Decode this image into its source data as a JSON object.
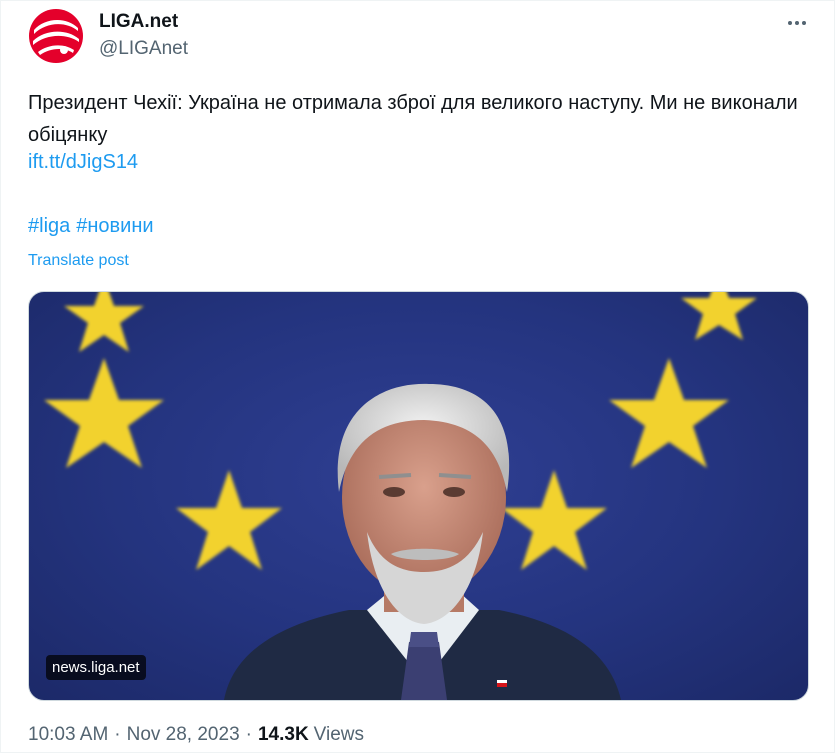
{
  "author": {
    "display_name": "LIGA.net",
    "handle": "@LIGAnet",
    "logo_color": "#e4002b"
  },
  "post": {
    "text": "Президент Чехії: Україна не отримала зброї для великого наступу. Ми не виконали обіцянку",
    "link": "ift.tt/dJigS14",
    "hashtags": [
      "#liga",
      "#новини"
    ],
    "translate_label": "Translate post"
  },
  "media": {
    "source_badge": "news.liga.net",
    "flag_color": "#24347f",
    "star_color": "#f2d22e"
  },
  "meta": {
    "time": "10:03 AM",
    "separator": "·",
    "date": "Nov 28, 2023",
    "views_count": "14.3K",
    "views_label": "Views"
  },
  "colors": {
    "accent": "#1d9bf0",
    "secondary_text": "#536471",
    "primary_text": "#0f1419"
  },
  "icons": {
    "more": "more-horizontal-icon",
    "logo": "liga-logo-icon"
  }
}
